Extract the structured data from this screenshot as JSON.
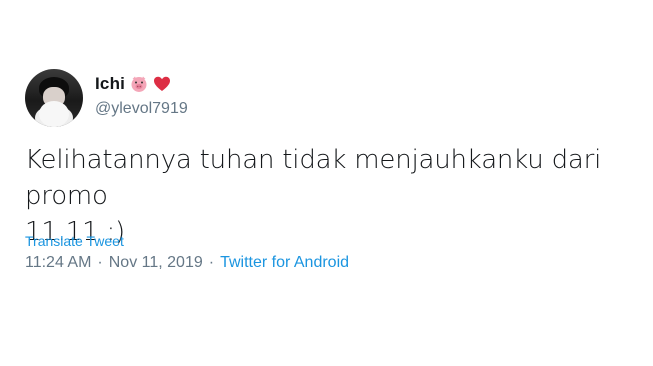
{
  "author": {
    "display_name": "Ichi",
    "handle": "@ylevol7919",
    "name_emojis": [
      "pig-face-emoji",
      "red-heart-emoji"
    ]
  },
  "tweet": {
    "text": "Kelihatannya tuhan tidak menjauhkanku dari promo\n11.11 :)",
    "translate_label": "Translate Tweet",
    "time": "11:24 AM",
    "separator": "·",
    "date": "Nov 11, 2019",
    "source": "Twitter for Android"
  },
  "colors": {
    "link": "#1b95e0",
    "secondary_text": "#657786",
    "primary_text": "#14171a"
  }
}
